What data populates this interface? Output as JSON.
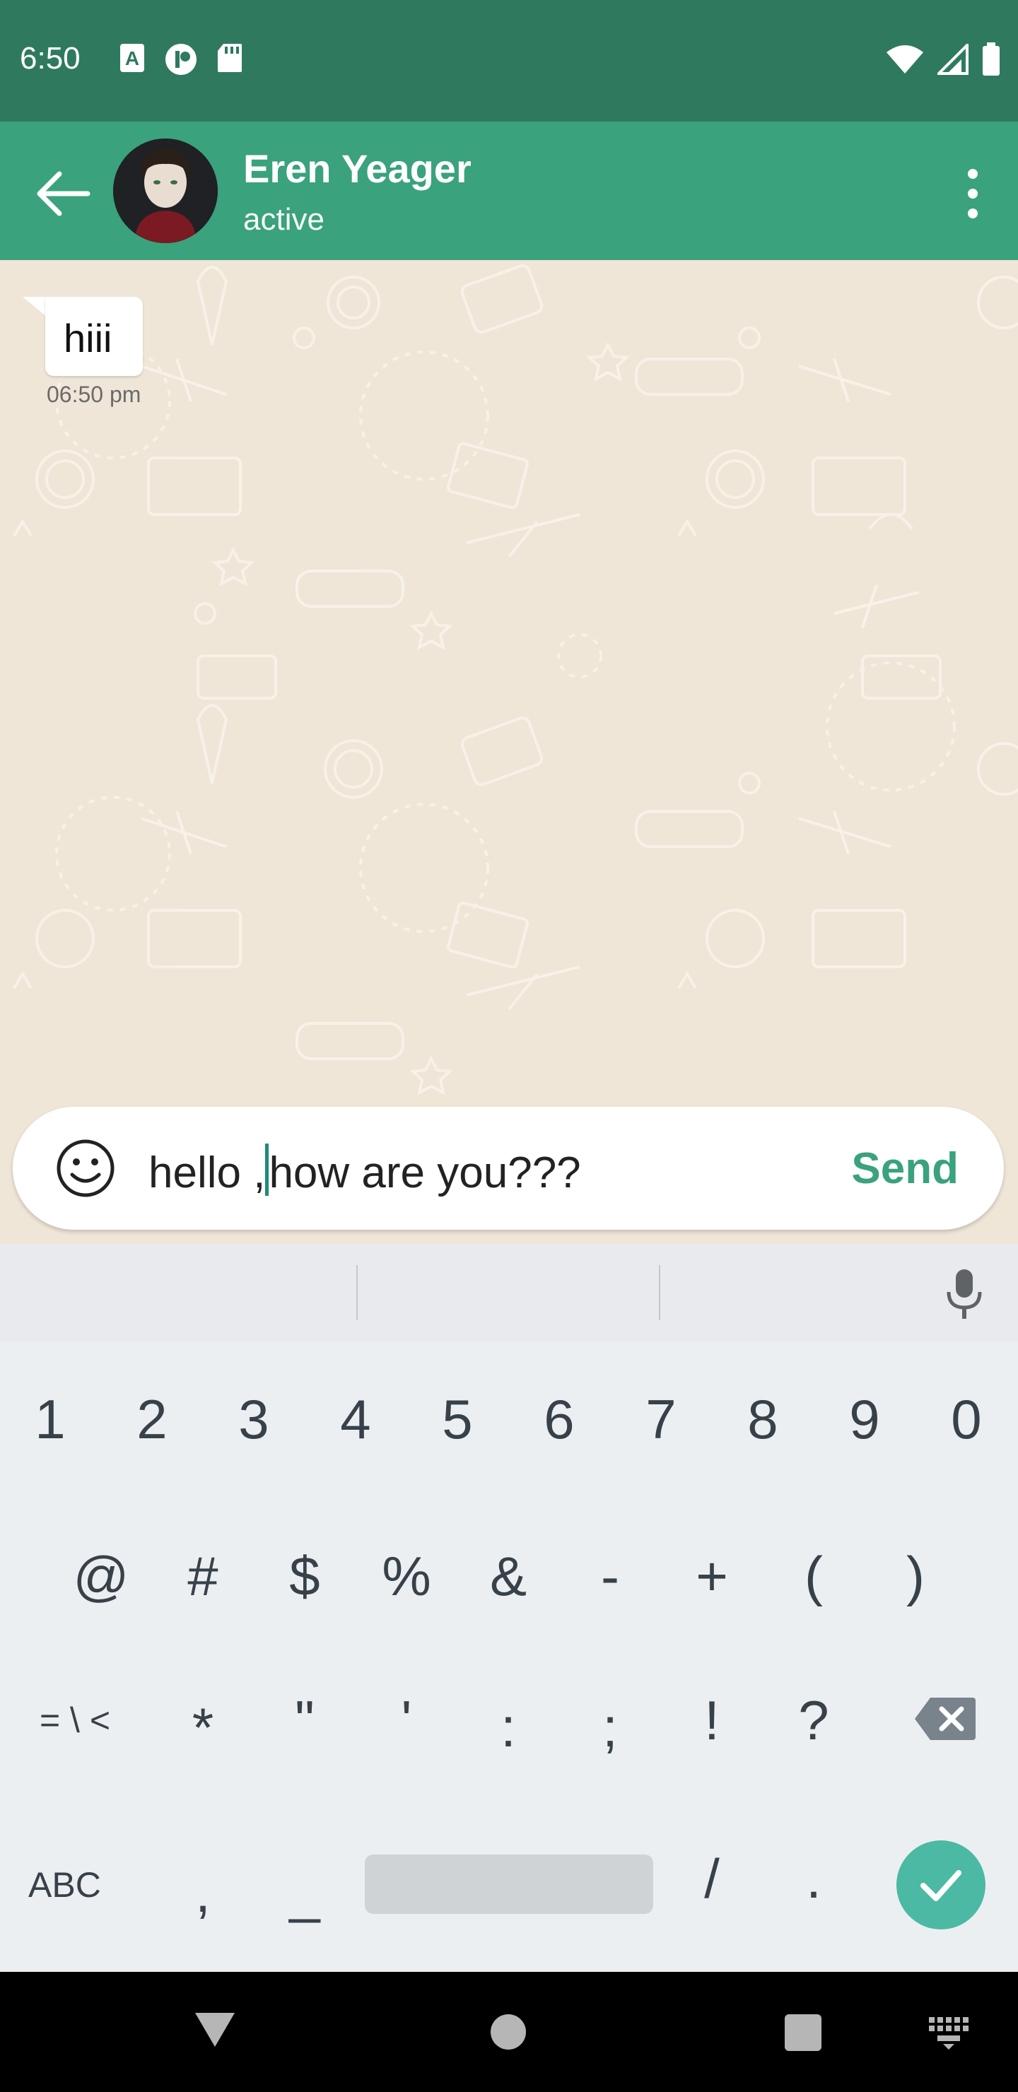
{
  "status_bar": {
    "time": "6:50",
    "left_icons": [
      "text-a-icon",
      "alarm-icon",
      "sd-card-icon"
    ],
    "right_icons": [
      "wifi-icon",
      "signal-icon",
      "battery-icon"
    ]
  },
  "header": {
    "contact_name": "Eren Yeager",
    "contact_status": "active"
  },
  "messages": [
    {
      "text": "hiii",
      "time": "06:50 pm",
      "direction": "incoming"
    }
  ],
  "composer": {
    "text_before_cursor": "hello ,",
    "text_after_cursor": "how are you???",
    "send_label": "Send"
  },
  "keyboard": {
    "row1": [
      "1",
      "2",
      "3",
      "4",
      "5",
      "6",
      "7",
      "8",
      "9",
      "0"
    ],
    "row2": [
      "@",
      "#",
      "$",
      "%",
      "&",
      "-",
      "+",
      "(",
      ")"
    ],
    "row3": [
      "= \\ <",
      "*",
      "\"",
      "'",
      ":",
      ";",
      "!",
      "?"
    ],
    "row4": [
      "ABC",
      ",",
      "_",
      "/",
      "."
    ]
  },
  "colors": {
    "status_bar": "#2f7a5f",
    "app_bar": "#3aa27c",
    "chat_background": "#efe6d8",
    "send": "#3aa27c",
    "done_key": "#4bb9a4"
  }
}
